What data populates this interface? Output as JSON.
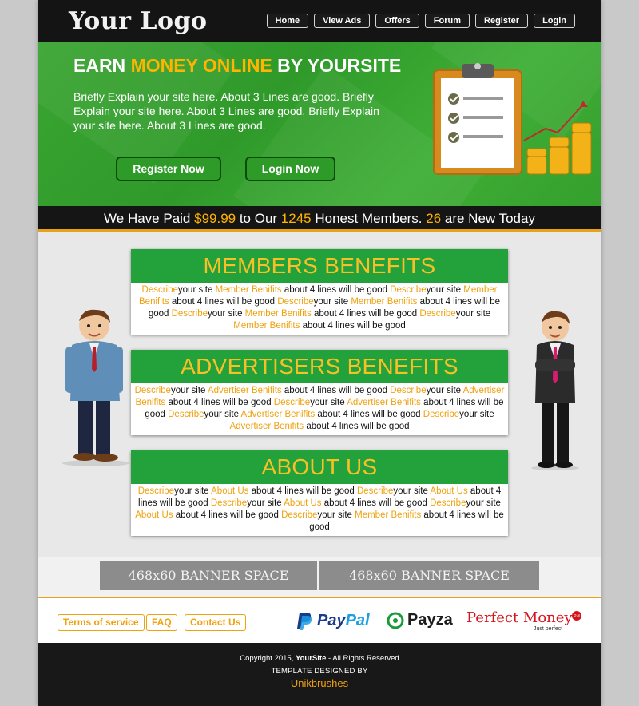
{
  "header": {
    "logo": "Your Logo",
    "nav": [
      "Home",
      "View Ads",
      "Offers",
      "Forum",
      "Register",
      "Login"
    ]
  },
  "hero": {
    "title_part1": "EARN ",
    "title_highlight": "MONEY ONLINE",
    "title_part2": " BY YOURSITE",
    "text": "Briefly Explain your site here. About 3 Lines are good. Briefly Explain your site here. About 3 Lines are good. Briefly Explain your site here. About 3 Lines are good.",
    "register_label": "Register Now",
    "login_label": "Login Now"
  },
  "paid_strip": {
    "part1": "We Have Paid ",
    "amount": "$99.99",
    "part2": " to Our ",
    "members": "1245",
    "part3": " Honest Members. ",
    "new_today": "26",
    "part4": " are New Today"
  },
  "boxes": {
    "members": {
      "title": "MEMBERS BENEFITS",
      "accent": "Describe",
      "link": "Member Benifits"
    },
    "advertisers": {
      "title": "ADVERTISERS BENEFITS",
      "accent": "Describe",
      "link": "Advertiser Benifits"
    },
    "about": {
      "title": "ABOUT US",
      "accent": "Describe",
      "link": "About Us"
    },
    "phrase_mid": "your site ",
    "phrase_end": " about 4 lines will be good "
  },
  "banners": [
    "468x60 BANNER SPACE",
    "468x60 BANNER SPACE"
  ],
  "footer_links": [
    "Terms of service",
    "FAQ",
    "Contact Us"
  ],
  "payments": {
    "paypal_pay": "Pay",
    "paypal_pal": "Pal",
    "payza": "Payza",
    "perfect_money": "Perfect Money",
    "perfect_money_sub": "Just perfect",
    "perfect_money_badge": "PM"
  },
  "footer": {
    "copyright_prefix": "Copyright 2015, ",
    "site": "YourSite",
    "copyright_suffix": " - All Rights Reserved",
    "designed_by": "TEMPLATE DESIGNED BY",
    "designer": "Unikbrushes"
  },
  "colors": {
    "accent_orange": "#f0a10e",
    "green": "#23a13a",
    "dark": "#141414"
  }
}
